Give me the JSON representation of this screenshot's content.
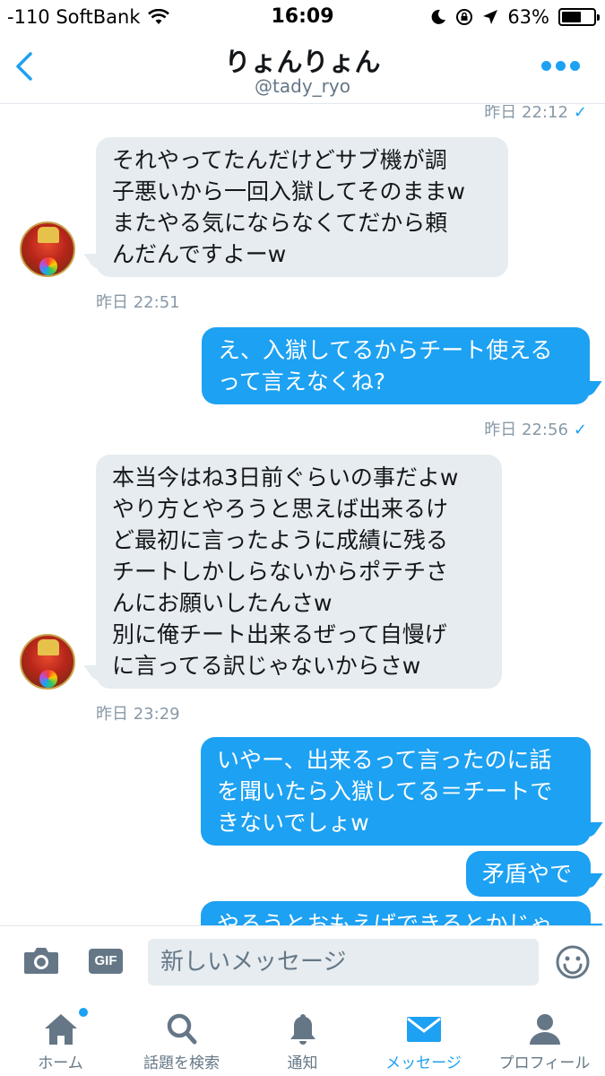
{
  "status_bar": {
    "carrier": "-110 SoftBank",
    "time": "16:09",
    "battery": "63%",
    "battery_level": 0.63
  },
  "header": {
    "name": "りょんりょん",
    "handle": "@tady_ryo"
  },
  "messages": [
    {
      "kind": "timestamp",
      "text": "昨日 22:12",
      "read": "✓"
    },
    {
      "kind": "in",
      "text": "それやってたんだけどサブ機が調\n子悪いから一回入獄してそのままw\nまたやる気にならなくてだから頼\nんだんですよーw"
    },
    {
      "kind": "timestamp",
      "text": "昨日 22:51"
    },
    {
      "kind": "out",
      "text": "え、入獄してるからチート使える\nって言えなくね?"
    },
    {
      "kind": "timestamp",
      "text": "昨日 22:56",
      "read": "✓"
    },
    {
      "kind": "in",
      "text": "本当今はね3日前ぐらいの事だよw\nやり方とやろうと思えば出来るけ\nど最初に言ったように成績に残る\nチートしかしらないからポテチさ\nんにお願いしたんさw\n別に俺チート出来るぜって自慢げ\nに言ってる訳じゃないからさw"
    },
    {
      "kind": "timestamp",
      "text": "昨日 23:29"
    },
    {
      "kind": "out",
      "text": "いやー、出来るって言ったのに話\nを聞いたら入獄してる＝チートで\nきないでしょw"
    },
    {
      "kind": "out",
      "text": "矛盾やで"
    },
    {
      "kind": "out",
      "text": "やろうとおもえばできるとかじゃ"
    }
  ],
  "composer": {
    "gif_label": "GIF",
    "placeholder": "新しいメッセージ"
  },
  "tabs": [
    {
      "label": "ホーム",
      "icon": "home-icon"
    },
    {
      "label": "話題を検索",
      "icon": "search-icon"
    },
    {
      "label": "通知",
      "icon": "bell-icon"
    },
    {
      "label": "メッセージ",
      "icon": "envelope-icon",
      "active": true
    },
    {
      "label": "プロフィール",
      "icon": "person-icon"
    }
  ],
  "colors": {
    "accent": "#1da1f2",
    "incoming_bubble": "#e6ecf0",
    "muted": "#657786"
  }
}
